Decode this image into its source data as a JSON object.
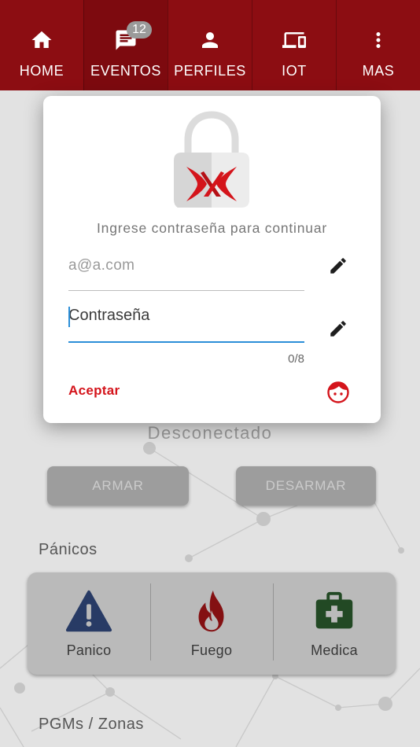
{
  "colors": {
    "brand_red": "#8c0d12",
    "accent_red": "#d4141b",
    "focus_blue": "#2c8fd8"
  },
  "nav": {
    "items": [
      {
        "label": "HOME",
        "icon": "home-icon"
      },
      {
        "label": "EVENTOS",
        "icon": "chat-icon",
        "badge": "12"
      },
      {
        "label": "PERFILES",
        "icon": "person-icon"
      },
      {
        "label": "IOT",
        "icon": "devices-icon"
      },
      {
        "label": "MAS",
        "icon": "more-vertical-icon"
      }
    ]
  },
  "main": {
    "status": "Desconectado",
    "arm_label": "ARMAR",
    "disarm_label": "DESARMAR",
    "panics_title": "Pánicos",
    "panics": [
      {
        "label": "Panico",
        "icon": "warning-icon"
      },
      {
        "label": "Fuego",
        "icon": "fire-icon"
      },
      {
        "label": "Medica",
        "icon": "medical-kit-icon"
      }
    ],
    "pgm_title": "PGMs / Zonas"
  },
  "dialog": {
    "prompt": "Ingrese contraseña para continuar",
    "email_value": "a@a.com",
    "password_placeholder": "Contraseña",
    "password_value": "",
    "counter": "0/8",
    "accept_label": "Aceptar",
    "email_edit_icon": "pencil-icon",
    "password_edit_icon": "pencil-icon",
    "face_icon": "face-icon",
    "logo_icon": "lock-logo-icon"
  }
}
